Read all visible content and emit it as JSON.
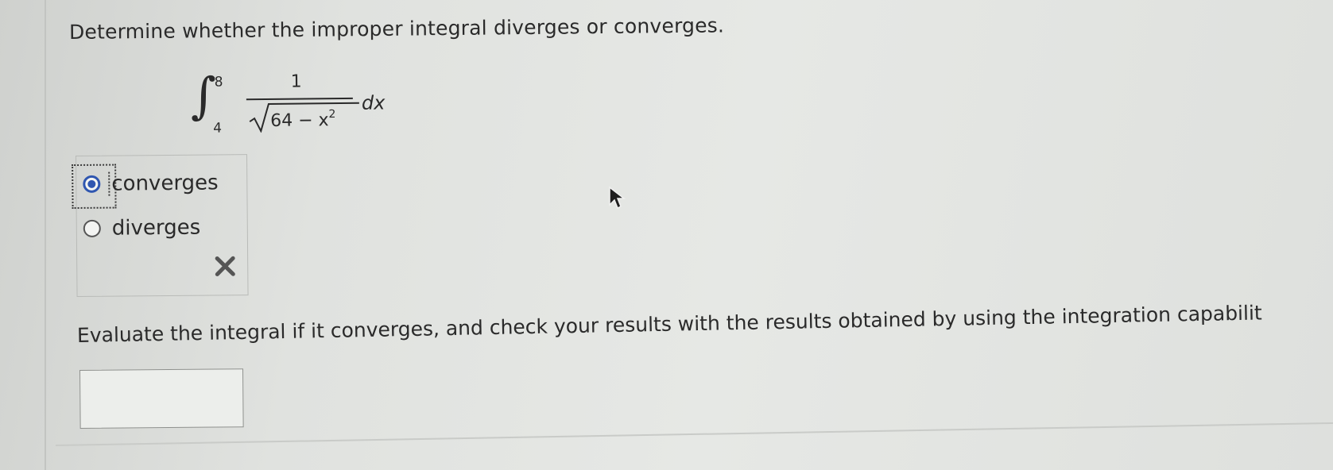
{
  "question": {
    "title": "Determine whether the improper integral diverges or converges."
  },
  "integral": {
    "lower_limit": "4",
    "upper_limit": "8",
    "numerator": "1",
    "radicand_text": "64 − x",
    "radicand_exponent": "2",
    "differential": "dx"
  },
  "options": {
    "items": [
      {
        "label": "converges",
        "selected": true
      },
      {
        "label": "diverges",
        "selected": false
      }
    ],
    "result_icon": "cross-icon",
    "result_color": "#555555"
  },
  "evaluate": {
    "instruction": "Evaluate the integral if it converges, and check your results with the results obtained by using the integration capabilit",
    "answer_value": ""
  },
  "colors": {
    "radio_selected": "#2f56b0",
    "text": "#2a2a2a"
  }
}
